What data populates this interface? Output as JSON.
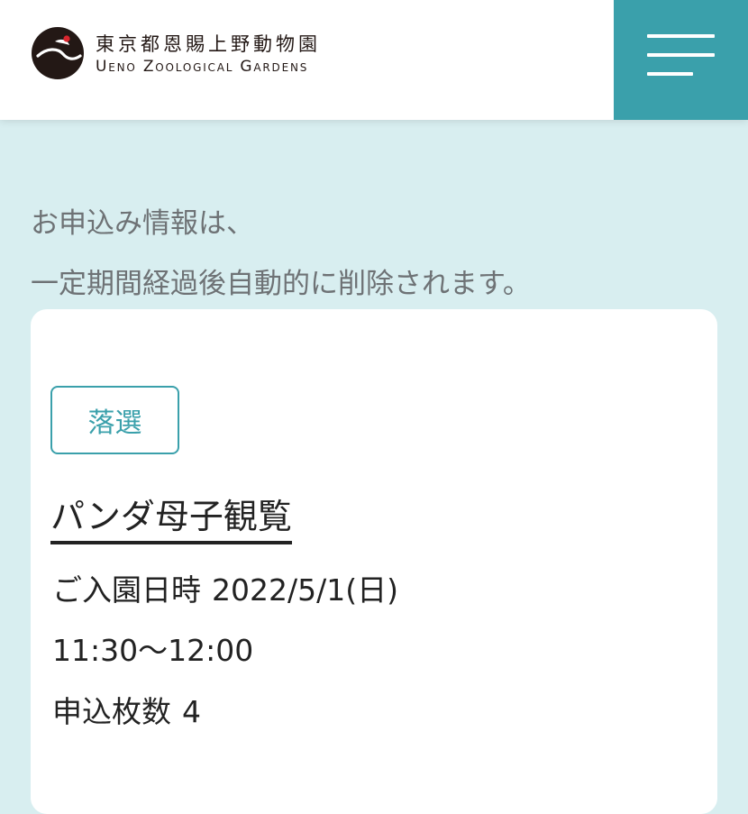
{
  "header": {
    "logo_icon": "crane-logo-icon",
    "logo_jp": "東京都恩賜上野動物園",
    "logo_en": "Ueno Zoological Gardens",
    "menu_icon": "hamburger-menu-icon",
    "menu_bg_color": "#3aa0ab"
  },
  "notice": {
    "line1": "お申込み情報は、",
    "line2": "一定期間経過後自動的に削除されます。"
  },
  "application": {
    "status": "落選",
    "title": "パンダ母子観覧",
    "visit_label": "ご入園日時",
    "visit_date": "2022/5/1(日)",
    "visit_time": "11:30〜12:00",
    "tickets_label": "申込枚数",
    "tickets_value": "4"
  },
  "colors": {
    "page_background": "#d8eef0",
    "accent": "#3aa0ab",
    "card_background": "#ffffff"
  }
}
